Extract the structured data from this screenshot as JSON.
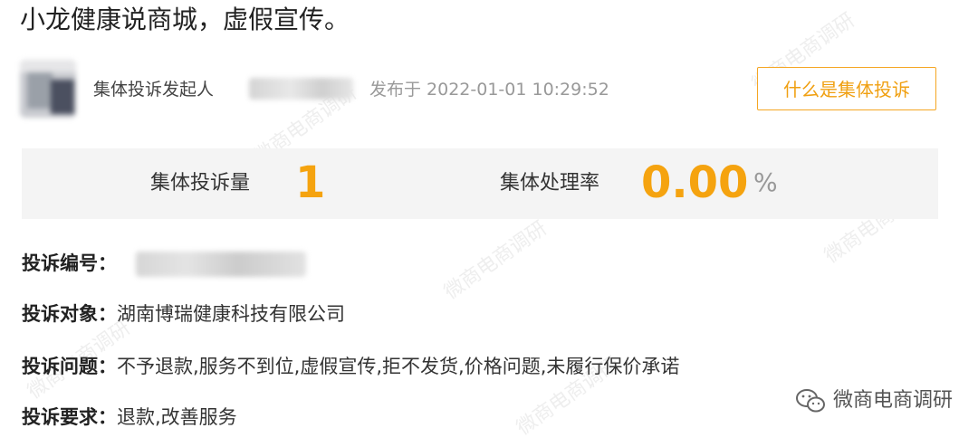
{
  "post": {
    "title": "小龙健康说商城，虚假宣传。",
    "initiator_label": "集体投诉发起人",
    "published_prefix": "发布于",
    "published_time": "2022-01-01 10:29:52",
    "what_is_button": "什么是集体投诉"
  },
  "stats": {
    "count_label": "集体投诉量",
    "count_value": "1",
    "rate_label": "集体处理率",
    "rate_value": "0.00",
    "rate_unit": "%"
  },
  "details": {
    "id_label": "投诉编号：",
    "target_label": "投诉对象：",
    "target_value": "湖南博瑞健康科技有限公司",
    "issue_label": "投诉问题：",
    "issue_value": "不予退款,服务不到位,虚假宣传,拒不发货,价格问题,未履行保价承诺",
    "request_label": "投诉要求：",
    "request_value": "退款,改善服务"
  },
  "watermark": {
    "text": "微商电商调研",
    "icon": "wechat-icon",
    "background_text": "微商电商调研"
  },
  "colors": {
    "accent": "#f5a30f",
    "stats_bg": "#f4f4f4"
  }
}
